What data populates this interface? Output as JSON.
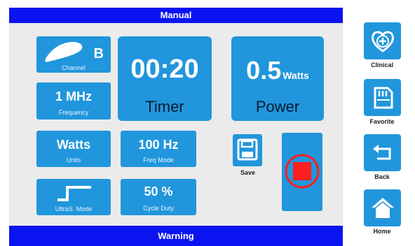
{
  "header": {
    "title": "Manual"
  },
  "footer": {
    "warning": "Warning"
  },
  "tiles": {
    "channel": {
      "value": "B",
      "label": "Channel"
    },
    "frequency": {
      "value": "1 MHz",
      "label": "Frequency"
    },
    "units": {
      "value": "Watts",
      "label": "Units"
    },
    "ultras_mode": {
      "label": "UltraS. Mode"
    },
    "timer": {
      "value": "00:20",
      "label": "Timer"
    },
    "freq_mode": {
      "value": "100 Hz",
      "label": "Freq Mode"
    },
    "cycle_duty": {
      "value": "50 %",
      "label": "Cycle Duty"
    },
    "power": {
      "value": "0.5",
      "unit": "Watts",
      "label": "Power"
    }
  },
  "actions": {
    "save_label": "Save",
    "stop_color": "#ff1f1f"
  },
  "sidebar": {
    "items": [
      {
        "label": "Clinical",
        "icon": "heart-plus-icon"
      },
      {
        "label": "Favorite",
        "icon": "sd-card-icon"
      },
      {
        "label": "Back",
        "icon": "back-arrow-icon"
      },
      {
        "label": "Home",
        "icon": "home-icon"
      }
    ]
  },
  "colors": {
    "bar_blue": "#0b14f0",
    "tile_blue": "#2196dc",
    "panel_gray": "#ebebeb"
  }
}
